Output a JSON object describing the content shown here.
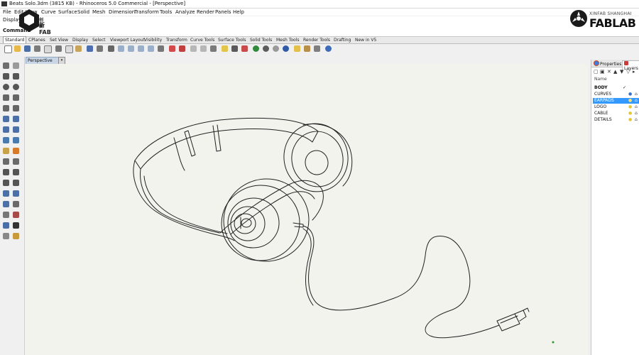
{
  "window": {
    "title": "Beats Solo.3dm (3815 KB) - Rhinoceros 5.0 Commercial - [Perspective]"
  },
  "menu": [
    "File",
    "Edit",
    "View",
    "Curve",
    "Surface",
    "Solid",
    "Mesh",
    "Dimension",
    "Transform",
    "Tools",
    "Analyze",
    "Render",
    "Panels",
    "Help"
  ],
  "command_area": {
    "history_line": "Display",
    "prompt_label": "Command"
  },
  "watermark_left": {
    "line1": "创新",
    "line2": "新FAB"
  },
  "watermark_right": {
    "small": "XINFAB SHANGHAI",
    "big": "FABLAB"
  },
  "tabs": [
    "Standard",
    "CPlanes",
    "Set View",
    "Display",
    "Select",
    "Viewport Layout",
    "Visibility",
    "Transform",
    "Curve Tools",
    "Surface Tools",
    "Solid Tools",
    "Mesh Tools",
    "Render Tools",
    "Drafting",
    "New in V5"
  ],
  "viewport": {
    "label": "Perspective",
    "menu_glyph": "▾"
  },
  "panel": {
    "tabs": [
      "Properties",
      "Layers"
    ],
    "column_name": "Name",
    "layers": [
      {
        "name": "BODY",
        "current": true,
        "selected": false
      },
      {
        "name": "CURVES",
        "current": false,
        "selected": false
      },
      {
        "name": "EARPADS",
        "current": false,
        "selected": true
      },
      {
        "name": "LOGO",
        "current": false,
        "selected": false
      },
      {
        "name": "CABLE",
        "current": false,
        "selected": false
      },
      {
        "name": "DETAILS",
        "current": false,
        "selected": false
      }
    ],
    "check_glyph": "✓"
  },
  "colors": {
    "accent": "#3399ff",
    "viewport_bg": "#f3f3ee",
    "label_bg": "#c9d6e6"
  }
}
